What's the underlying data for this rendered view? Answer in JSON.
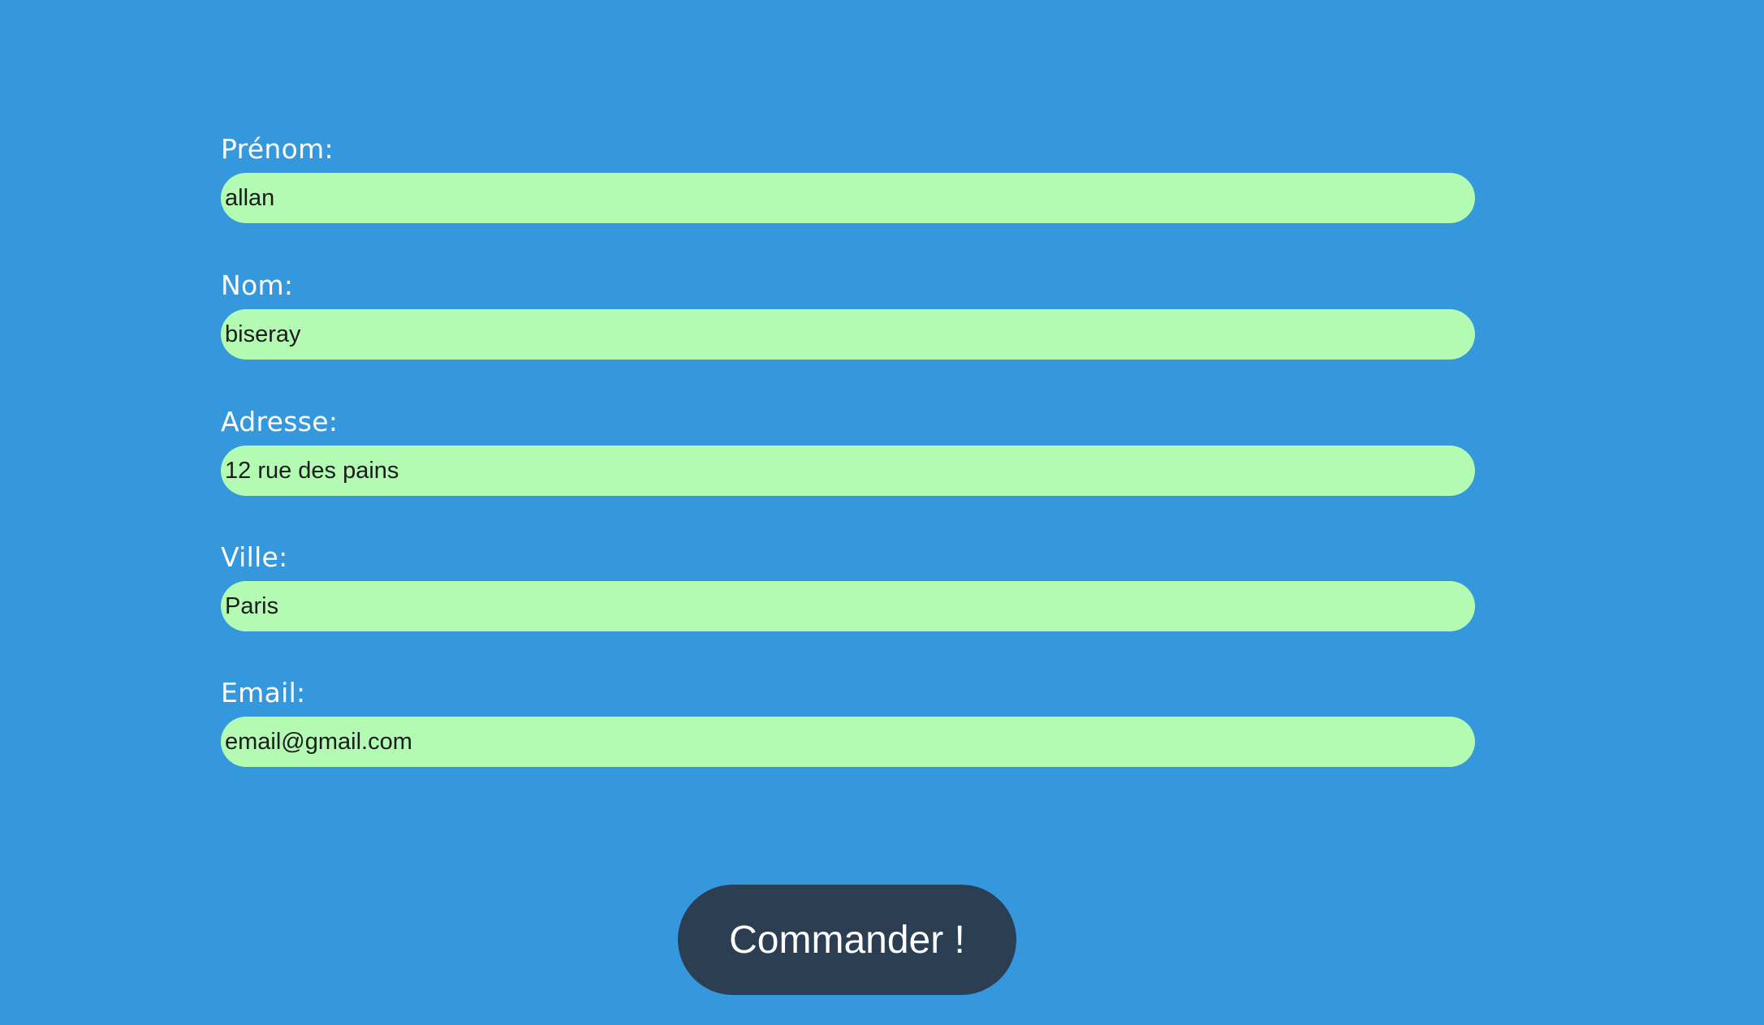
{
  "form": {
    "fields": [
      {
        "label": "Prénom:",
        "value": "allan"
      },
      {
        "label": "Nom:",
        "value": "biseray"
      },
      {
        "label": "Adresse:",
        "value": "12 rue des pains"
      },
      {
        "label": "Ville:",
        "value": "Paris"
      },
      {
        "label": "Email:",
        "value": "email@gmail.com"
      }
    ],
    "submit_label": "Commander !"
  },
  "colors": {
    "background": "#3698dc",
    "input_background": "#b3fbb2",
    "button_background": "#2c3e52",
    "label_text": "#ffffff"
  }
}
